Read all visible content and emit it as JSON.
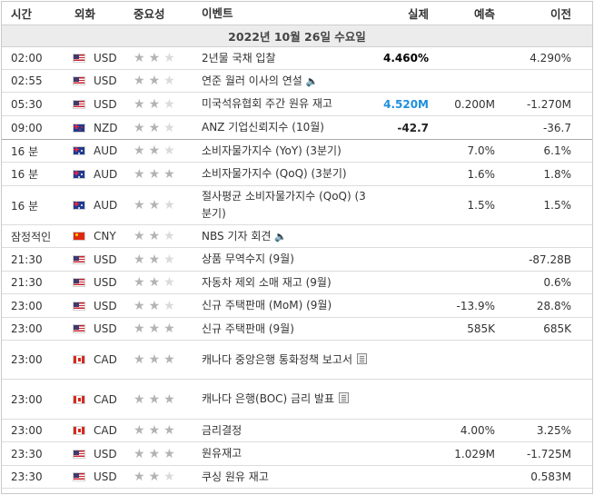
{
  "headers": {
    "time": "시간",
    "currency": "외화",
    "importance": "중요성",
    "event": "이벤트",
    "actual": "실제",
    "forecast": "예측",
    "previous": "이전"
  },
  "date_label": "2022년 10월 26일 수요일",
  "rows": [
    {
      "time": "02:00",
      "flag": "us",
      "currency": "USD",
      "stars": 2,
      "event": "2년물 국채 입찰",
      "actual": "4.460%",
      "actual_style": "bold",
      "forecast": "",
      "previous": "4.290%"
    },
    {
      "time": "02:55",
      "flag": "us",
      "currency": "USD",
      "stars": 2,
      "event": "연준 월러 이사의 연설",
      "speaker": true,
      "actual": "",
      "forecast": "",
      "previous": ""
    },
    {
      "time": "05:30",
      "flag": "us",
      "currency": "USD",
      "stars": 2,
      "event": "미국석유협회 주간 원유 재고",
      "actual": "4.520M",
      "actual_style": "blue",
      "forecast": "0.200M",
      "previous": "-1.270M"
    },
    {
      "time": "09:00",
      "flag": "nz",
      "currency": "NZD",
      "stars": 2,
      "event": "ANZ 기업신뢰지수 (10월)",
      "actual": "-42.7",
      "actual_style": "dark",
      "forecast": "",
      "previous": "-36.7"
    },
    {
      "time": "16 분",
      "flag": "au",
      "currency": "AUD",
      "stars": 2,
      "event": "소비자물가지수 (YoY) (3분기)",
      "actual": "",
      "forecast": "7.0%",
      "previous": "6.1%"
    },
    {
      "time": "16 분",
      "flag": "au",
      "currency": "AUD",
      "stars": 3,
      "event": "소비자물가지수 (QoQ) (3분기)",
      "actual": "",
      "forecast": "1.6%",
      "previous": "1.8%"
    },
    {
      "time": "16 분",
      "flag": "au",
      "currency": "AUD",
      "stars": 2,
      "event": "절사평균 소비자물가지수 (QoQ) (3분기)",
      "actual": "",
      "forecast": "1.5%",
      "previous": "1.5%"
    },
    {
      "time": "잠정적인",
      "flag": "cn",
      "currency": "CNY",
      "stars": 2,
      "event": "NBS 기자 회견",
      "speaker": true,
      "actual": "",
      "forecast": "",
      "previous": ""
    },
    {
      "time": "21:30",
      "flag": "us",
      "currency": "USD",
      "stars": 2,
      "event": "상품 무역수지 (9월)",
      "actual": "",
      "forecast": "",
      "previous": "-87.28B"
    },
    {
      "time": "21:30",
      "flag": "us",
      "currency": "USD",
      "stars": 2,
      "event": "자동차 제외 소매 재고 (9월)",
      "actual": "",
      "forecast": "",
      "previous": "0.6%"
    },
    {
      "time": "23:00",
      "flag": "us",
      "currency": "USD",
      "stars": 2,
      "event": "신규 주택판매 (MoM) (9월)",
      "actual": "",
      "forecast": "-13.9%",
      "previous": "28.8%"
    },
    {
      "time": "23:00",
      "flag": "us",
      "currency": "USD",
      "stars": 3,
      "event": "신규 주택판매 (9월)",
      "actual": "",
      "forecast": "585K",
      "previous": "685K"
    },
    {
      "time": "23:00",
      "flag": "ca",
      "currency": "CAD",
      "stars": 3,
      "event": "캐나다 중앙은행 통화정책 보고서",
      "doc": true,
      "actual": "",
      "forecast": "",
      "previous": ""
    },
    {
      "time": "23:00",
      "flag": "ca",
      "currency": "CAD",
      "stars": 3,
      "event": "캐나다 은행(BOC) 금리 발표",
      "doc": true,
      "actual": "",
      "forecast": "",
      "previous": ""
    },
    {
      "time": "23:00",
      "flag": "ca",
      "currency": "CAD",
      "stars": 3,
      "event": "금리결정",
      "actual": "",
      "forecast": "4.00%",
      "previous": "3.25%"
    },
    {
      "time": "23:30",
      "flag": "us",
      "currency": "USD",
      "stars": 3,
      "event": "원유재고",
      "actual": "",
      "forecast": "1.029M",
      "previous": "-1.725M"
    },
    {
      "time": "23:30",
      "flag": "us",
      "currency": "USD",
      "stars": 2,
      "event": "쿠싱 원유 재고",
      "actual": "",
      "forecast": "",
      "previous": "0.583M"
    }
  ]
}
